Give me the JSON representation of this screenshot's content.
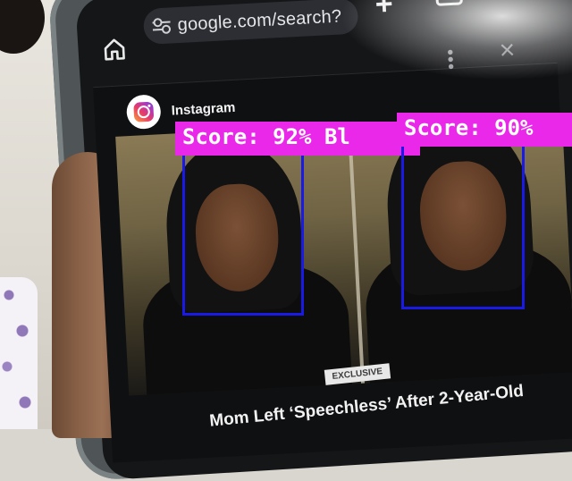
{
  "browser": {
    "url": "google.com/search?",
    "home_icon": "home-icon",
    "tune_icon": "tune-icon",
    "new_tab_icon": "plus-icon",
    "tabs_icon": "tabs-icon"
  },
  "card": {
    "source": "Instagram",
    "source_icon": "instagram-icon",
    "more_icon": "more-vert-icon",
    "close_icon": "close-icon",
    "badge": "EXCLUSIVE",
    "headline": "Mom Left ‘Speechless’ After 2-Year-Old"
  },
  "detections": [
    {
      "label": "Score: 92% Bl"
    },
    {
      "label": "Score: 90%"
    }
  ],
  "colors": {
    "detection_box": "#1a1ae6",
    "detection_label_bg": "#ea28ea",
    "label_text": "#ffffff"
  }
}
